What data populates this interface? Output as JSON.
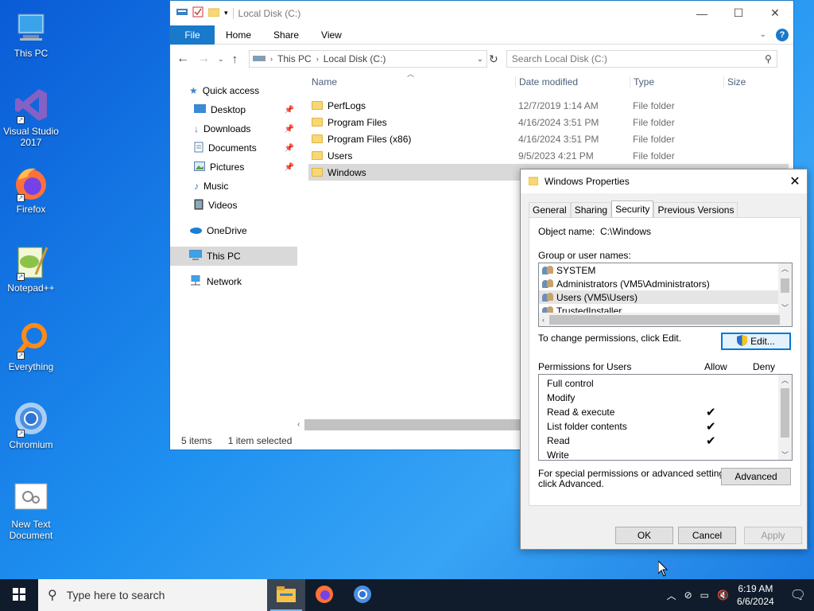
{
  "desktop": {
    "icons": [
      {
        "label": "This PC",
        "icon": "this-pc-icon"
      },
      {
        "label": "Visual Studio 2017",
        "icon": "visual-studio-icon"
      },
      {
        "label": "Firefox",
        "icon": "firefox-icon"
      },
      {
        "label": "Notepad++",
        "icon": "notepad-plus-plus-icon"
      },
      {
        "label": "Everything",
        "icon": "everything-search-icon"
      },
      {
        "label": "Chromium",
        "icon": "chromium-icon"
      },
      {
        "label": "New Text Document",
        "icon": "text-document-icon"
      }
    ]
  },
  "explorer": {
    "title": "Local Disk (C:)",
    "ribbon": {
      "file": "File",
      "home": "Home",
      "share": "Share",
      "view": "View"
    },
    "address": {
      "crumb1": "This PC",
      "crumb2": "Local Disk (C:)"
    },
    "search_placeholder": "Search Local Disk (C:)",
    "sidebar": {
      "quick_access": "Quick access",
      "desktop": "Desktop",
      "downloads": "Downloads",
      "documents": "Documents",
      "pictures": "Pictures",
      "music": "Music",
      "videos": "Videos",
      "onedrive": "OneDrive",
      "this_pc": "This PC",
      "network": "Network"
    },
    "columns": {
      "name": "Name",
      "date": "Date modified",
      "type": "Type",
      "size": "Size"
    },
    "files": [
      {
        "name": "PerfLogs",
        "date": "12/7/2019 1:14 AM",
        "type": "File folder"
      },
      {
        "name": "Program Files",
        "date": "4/16/2024 3:51 PM",
        "type": "File folder"
      },
      {
        "name": "Program Files (x86)",
        "date": "4/16/2024 3:51 PM",
        "type": "File folder"
      },
      {
        "name": "Users",
        "date": "9/5/2023 4:21 PM",
        "type": "File folder"
      },
      {
        "name": "Windows",
        "date": "",
        "type": ""
      }
    ],
    "status": {
      "items": "5 items",
      "selected": "1 item selected"
    }
  },
  "properties": {
    "title": "Windows Properties",
    "tabs": {
      "general": "General",
      "sharing": "Sharing",
      "security": "Security",
      "previous": "Previous Versions"
    },
    "object_label": "Object name:",
    "object_value": "C:\\Windows",
    "group_label": "Group or user names:",
    "groups": [
      "SYSTEM",
      "Administrators (VM5\\Administrators)",
      "Users (VM5\\Users)",
      "TrustedInstaller"
    ],
    "change_text": "To change permissions, click Edit.",
    "edit_button": "Edit...",
    "perm_header": "Permissions for Users",
    "allow_header": "Allow",
    "deny_header": "Deny",
    "permissions": [
      {
        "name": "Full control",
        "allow": ""
      },
      {
        "name": "Modify",
        "allow": ""
      },
      {
        "name": "Read & execute",
        "allow": "✔"
      },
      {
        "name": "List folder contents",
        "allow": "✔"
      },
      {
        "name": "Read",
        "allow": "✔"
      },
      {
        "name": "Write",
        "allow": ""
      }
    ],
    "advanced_text1": "For special permissions or advanced settings,",
    "advanced_text2": "click Advanced.",
    "advanced_button": "Advanced",
    "ok": "OK",
    "cancel": "Cancel",
    "apply": "Apply"
  },
  "taskbar": {
    "search_placeholder": "Type here to search",
    "time": "6:19 AM",
    "date": "6/6/2024"
  },
  "colors": {
    "accent": "#1979ca",
    "taskbar": "#101c2b",
    "folder": "#f8d775"
  }
}
